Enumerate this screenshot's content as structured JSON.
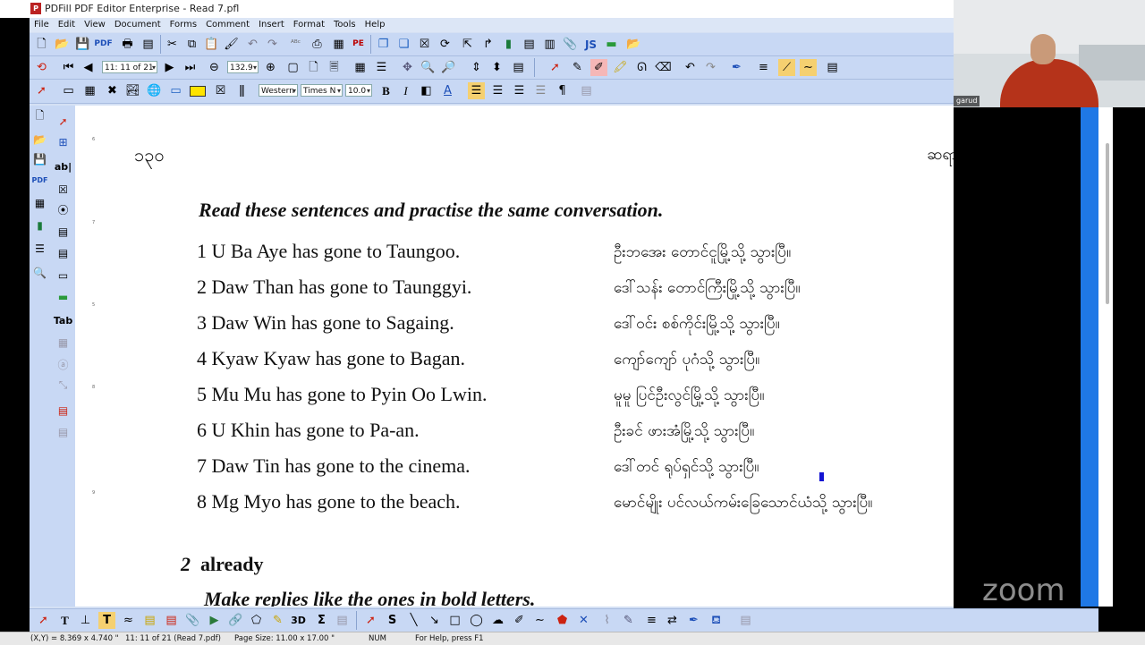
{
  "window": {
    "title": "PDFill PDF Editor Enterprise - Read 7.pfl"
  },
  "menu": [
    "File",
    "Edit",
    "View",
    "Document",
    "Forms",
    "Comment",
    "Insert",
    "Format",
    "Tools",
    "Help"
  ],
  "toolbar2": {
    "page_box": "11: 11 of 21",
    "zoom_box": "132.9"
  },
  "toolbar3": {
    "font_script": "Western",
    "font_name": "Times N",
    "font_size": "10.0"
  },
  "left_tools": {
    "text_field_label": "ab|",
    "tab_label": "Tab",
    "pdf_label": "PDF"
  },
  "bottom_toolbar": {
    "three_d_label": "3D",
    "sigma_label": "Σ",
    "s_label": "S",
    "text_T": "T"
  },
  "page": {
    "page_number": "၁၃၀",
    "running_header": "ဆရာဦးဉာဏ်လင်း",
    "instruction": "Read these sentences and practise the same conversation.",
    "rows": [
      {
        "en": "1 U Ba Aye has gone to Taungoo.",
        "my": "ဦးဘအေး တောင်ငူမြို့သို့ သွားပြီ။"
      },
      {
        "en": "2 Daw Than has gone to Taunggyi.",
        "my": "ဒေါ်သန်း တောင်ကြီးမြို့သို့ သွားပြီ။"
      },
      {
        "en": "3 Daw Win has gone to Sagaing.",
        "my": "ဒေါ်ဝင်း စစ်ကိုင်းမြို့သို့ သွားပြီ။"
      },
      {
        "en": "4 Kyaw Kyaw has gone to Bagan.",
        "my": "ကျော်ကျော် ပုဂံသို့ သွားပြီ။"
      },
      {
        "en": "5 Mu Mu has gone to Pyin Oo Lwin.",
        "my": "မူမူ ပြင်ဦးလွင်မြို့သို့ သွားပြီ။"
      },
      {
        "en": "6 U Khin has gone to Pa-an.",
        "my": "ဦးခင် ဖားအံမြို့သို့ သွားပြီ။"
      },
      {
        "en": "7 Daw Tin has gone to the cinema.",
        "my": "ဒေါ်တင် ရုပ်ရှင်သို့ သွားပြီ။"
      },
      {
        "en": "8 Mg Myo has gone to the beach.",
        "my": "မောင်မျိုး ပင်လယ်ကမ်းခြေသောင်ယံသို့ သွားပြီ။"
      }
    ],
    "section_number": "2",
    "section_title": "already",
    "subinstruction": "Make replies like the ones in bold letters."
  },
  "video": {
    "participant_name": "garud",
    "watermark": "zoom"
  },
  "status": {
    "coords": "(X,Y) = 8.369 x 4.740 \"",
    "page_info": "11: 11 of 21 (Read 7.pdf)",
    "page_size": "Page Size: 11.00 x 17.00 \"",
    "num": "NUM",
    "help": "For Help, press F1"
  },
  "colors": {
    "check_mark": "#1414d2",
    "toolbar": "#c8d8f4",
    "sidebar_accent": "#1f78e6"
  }
}
